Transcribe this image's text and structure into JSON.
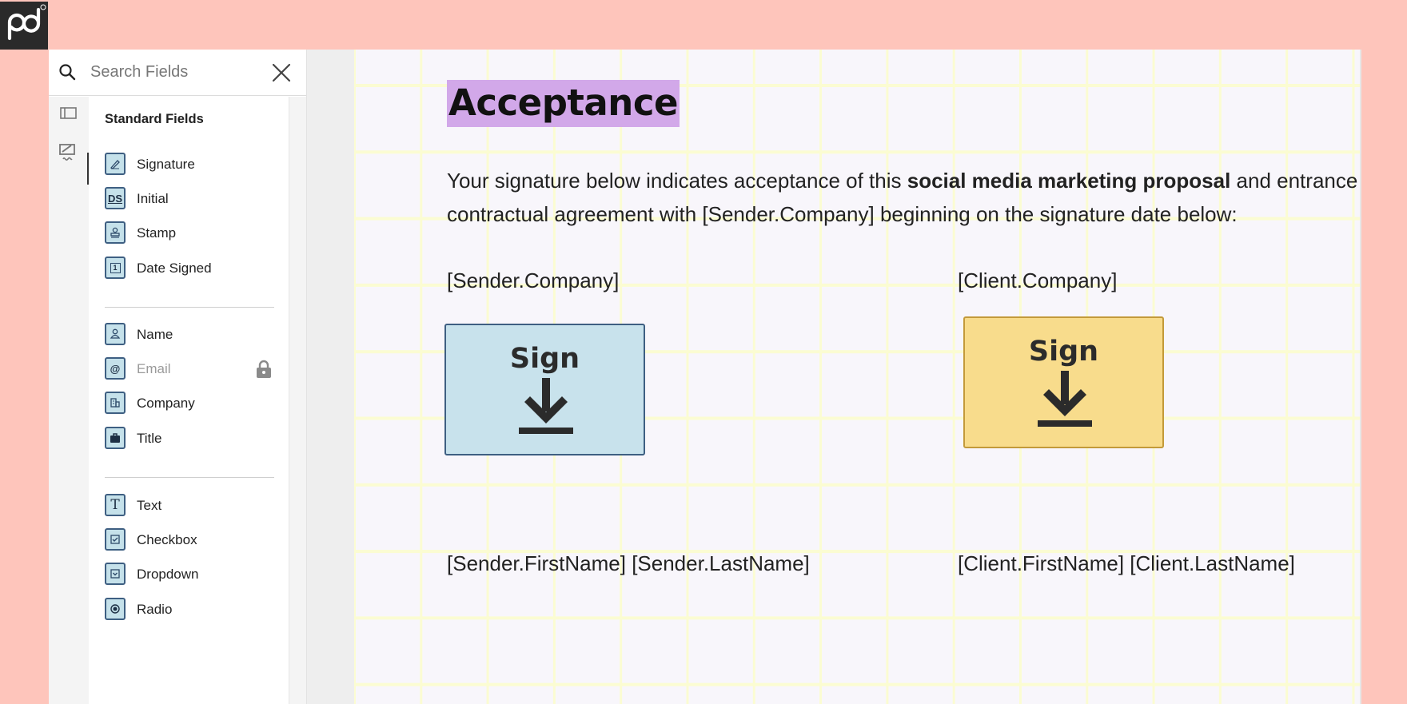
{
  "sidebar": {
    "search_placeholder": "Search Fields",
    "section_title": "Standard Fields",
    "groups": [
      [
        {
          "label": "Signature",
          "icon": "pen-icon"
        },
        {
          "label": "Initial",
          "icon": "initials-icon",
          "icon_text": "DS"
        },
        {
          "label": "Stamp",
          "icon": "stamp-icon"
        },
        {
          "label": "Date Signed",
          "icon": "calendar-icon",
          "icon_text": "1"
        }
      ],
      [
        {
          "label": "Name",
          "icon": "person-icon"
        },
        {
          "label": "Email",
          "icon": "at-icon",
          "locked": true
        },
        {
          "label": "Company",
          "icon": "building-icon"
        },
        {
          "label": "Title",
          "icon": "briefcase-icon"
        }
      ],
      [
        {
          "label": "Text",
          "icon": "text-icon",
          "icon_text": "T"
        },
        {
          "label": "Checkbox",
          "icon": "checkbox-icon"
        },
        {
          "label": "Dropdown",
          "icon": "dropdown-icon"
        },
        {
          "label": "Radio",
          "icon": "radio-icon"
        }
      ]
    ]
  },
  "document": {
    "heading": "Acceptance",
    "para_part1": "Your signature below indicates acceptance of this ",
    "para_bold": "social media marketing proposal",
    "para_part2": " and entrance into a",
    "para_line2": "contractual agreement with [Sender.Company] beginning on the signature date below:",
    "sender_company": "[Sender.Company]",
    "client_company": "[Client.Company]",
    "sender_name": "[Sender.FirstName] [Sender.LastName]",
    "client_name": "[Client.FirstName] [Client.LastName]",
    "sign_label": "Sign"
  },
  "colors": {
    "background": "#fec5bb",
    "sender_box": "#c8e2ec",
    "client_box": "#f8dc8c",
    "heading_highlight": "#d2a8e9"
  }
}
